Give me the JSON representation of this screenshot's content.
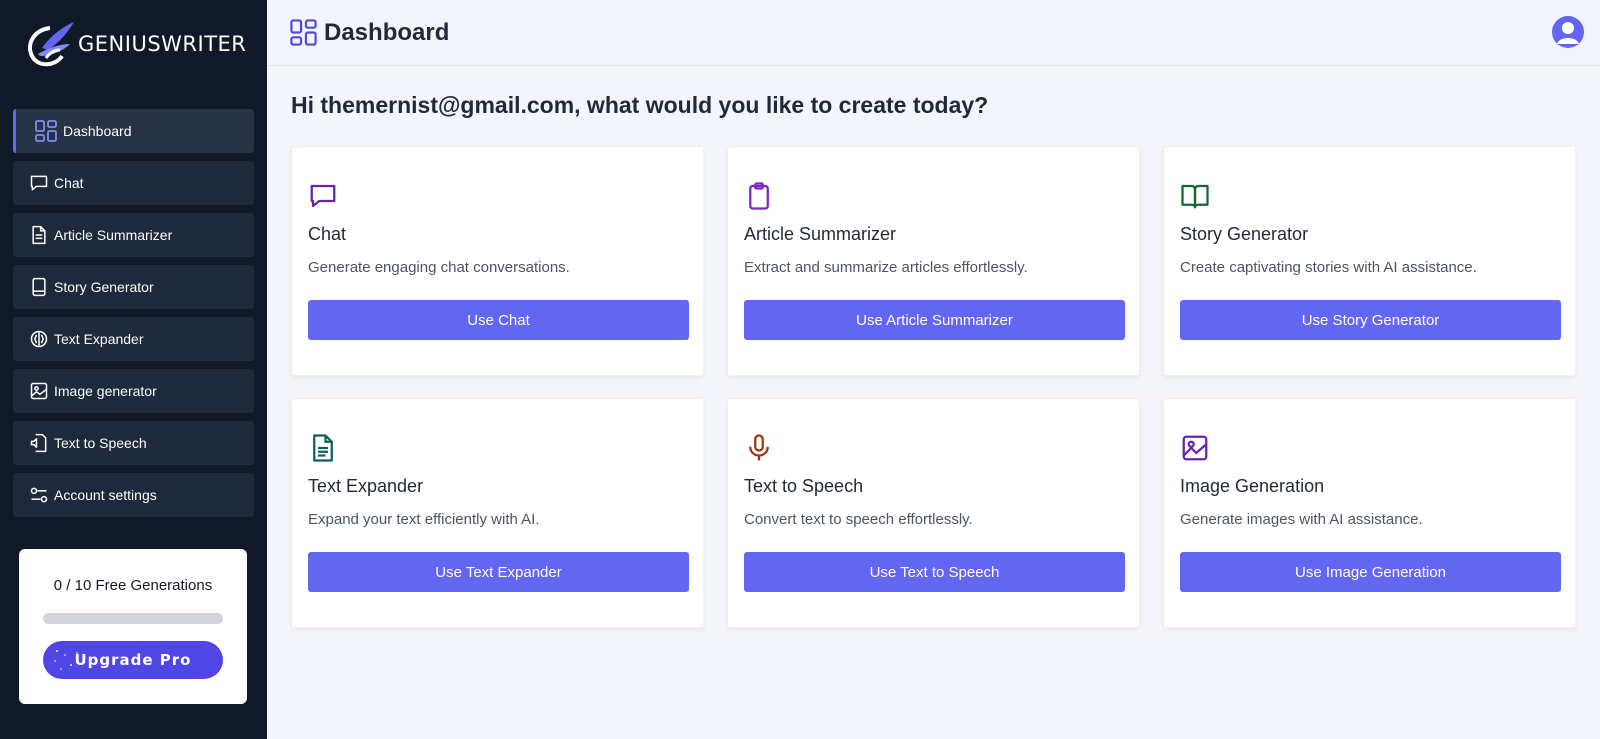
{
  "app": {
    "logo_text": "GENIUSWRITER"
  },
  "sidebar": {
    "items": [
      {
        "label": "Dashboard",
        "icon": "dashboard-grid-icon",
        "active": true
      },
      {
        "label": "Chat",
        "icon": "chat-bubble-icon"
      },
      {
        "label": "Article Summarizer",
        "icon": "document-icon"
      },
      {
        "label": "Story Generator",
        "icon": "book-icon"
      },
      {
        "label": "Text Expander",
        "icon": "text-expander-icon"
      },
      {
        "label": "Image generator",
        "icon": "image-icon"
      },
      {
        "label": "Text to Speech",
        "icon": "speech-icon"
      },
      {
        "label": "Account settings",
        "icon": "sliders-icon"
      }
    ],
    "generations": {
      "text": "0 / 10 Free Generations",
      "progress": 0
    },
    "upgrade_label": "Upgrade Pro"
  },
  "header": {
    "title": "Dashboard"
  },
  "main": {
    "greeting": "Hi themernist@gmail.com, what would you like to create today?",
    "cards": [
      {
        "title": "Chat",
        "description": "Generate engaging chat conversations.",
        "button": "Use Chat",
        "icon": "chat-bubble-icon",
        "color": "#6b21a8"
      },
      {
        "title": "Article Summarizer",
        "description": "Extract and summarize articles effortlessly.",
        "button": "Use Article Summarizer",
        "icon": "clipboard-icon",
        "color": "#7e22ce"
      },
      {
        "title": "Story Generator",
        "description": "Create captivating stories with AI assistance.",
        "button": "Use Story Generator",
        "icon": "open-book-icon",
        "color": "#166534"
      },
      {
        "title": "Text Expander",
        "description": "Expand your text efficiently with AI.",
        "button": "Use Text Expander",
        "icon": "document-lines-icon",
        "color": "#115e59"
      },
      {
        "title": "Text to Speech",
        "description": "Convert text to speech effortlessly.",
        "button": "Use Text to Speech",
        "icon": "microphone-icon",
        "color": "#9a3412"
      },
      {
        "title": "Image Generation",
        "description": "Generate images with AI assistance.",
        "button": "Use Image Generation",
        "icon": "image-icon",
        "color": "#6b21a8"
      }
    ]
  },
  "colors": {
    "sidebar_bg": "#111827",
    "nav_item_bg": "#1e293b",
    "accent": "#6366f1",
    "page_bg": "#f3f5fa"
  }
}
